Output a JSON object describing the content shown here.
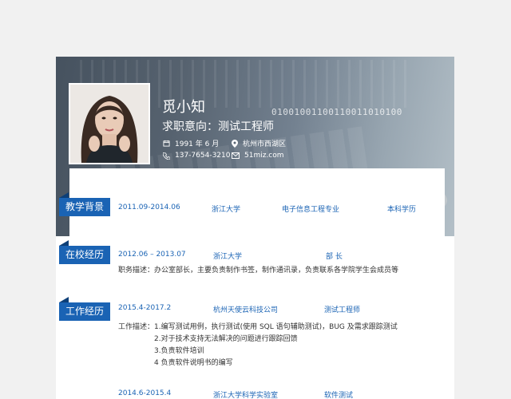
{
  "header": {
    "name": "觅小知",
    "objective": "求职意向：测试工程师",
    "binary_text": "01001001100110011010100",
    "birth": "1991 年 6 月",
    "location": "杭州市西湖区",
    "phone": "137-7654-3210",
    "email": "51miz.com"
  },
  "education": {
    "title": "教学背景",
    "period": "2011.09-2014.06",
    "school": "浙江大学",
    "major": "电子信息工程专业",
    "degree": "本科学历"
  },
  "campus": {
    "title": "在校经历",
    "period": "2012.06 – 2013.07",
    "org": "浙江大学",
    "role": "部  长",
    "desc": "职务描述：办公室部长，主要负责制作书签，制作通讯录，负责联系各学院学生会成员等"
  },
  "work": {
    "title": "工作经历",
    "job1": {
      "period": "2015.4-2017.2",
      "company": "杭州天使云科技公司",
      "position": "测试工程师",
      "desc_label": "工作描述：",
      "lines": [
        "1.编写测试用例，执行测试(使用 SQL 语句辅助测试)，BUG 及需求跟踪测试",
        "2.对于技术支持无法解决的问题进行跟踪回馈",
        "3.负责软件培训",
        "4 负责软件说明书的编写"
      ]
    },
    "job2": {
      "period": "2014.6-2015.4",
      "company": "浙江大学科学实验室",
      "position": "软件测试"
    }
  },
  "colors": {
    "accent": "#1a63b4",
    "accent_dark": "#0d3f78",
    "banner": "#56626f"
  },
  "icons": [
    "calendar-icon",
    "location-pin-icon",
    "phone-icon",
    "email-icon"
  ]
}
